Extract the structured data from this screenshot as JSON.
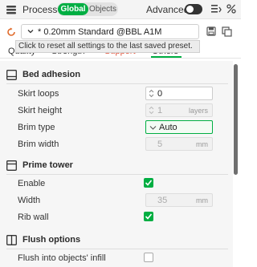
{
  "header": {
    "title": "Process",
    "mode_global": "Global",
    "mode_objects": "Objects",
    "advanced_label": "Advanced",
    "advanced_on": false,
    "icons": [
      "process-icon",
      "list-icon",
      "percent-icon"
    ]
  },
  "preset": {
    "name": "* 0.20mm Standard @BBL A1M",
    "tooltip": "Click to reset all settings to the last saved preset."
  },
  "tabs": [
    {
      "label": "Quality"
    },
    {
      "label": "Strength"
    },
    {
      "label": "Support"
    },
    {
      "label": "Others"
    }
  ],
  "active_tab": "Others",
  "sections": {
    "bed_adhesion": {
      "title": "Bed adhesion",
      "skirt_loops": {
        "label": "Skirt loops",
        "value": "0"
      },
      "skirt_height": {
        "label": "Skirt height",
        "value": "1",
        "unit": "layers"
      },
      "brim_type": {
        "label": "Brim type",
        "value": "Auto"
      },
      "brim_width": {
        "label": "Brim width",
        "value": "5",
        "unit": "mm"
      }
    },
    "prime_tower": {
      "title": "Prime tower",
      "enable": {
        "label": "Enable",
        "checked": true
      },
      "width": {
        "label": "Width",
        "value": "35",
        "unit": "mm"
      },
      "rib_wall": {
        "label": "Rib wall",
        "checked": true
      }
    },
    "flush_options": {
      "title": "Flush options",
      "flush_infill": {
        "label": "Flush into objects' infill",
        "checked": false
      }
    }
  },
  "colors": {
    "accent": "#00ae42",
    "support_tab": "#e0523a"
  }
}
